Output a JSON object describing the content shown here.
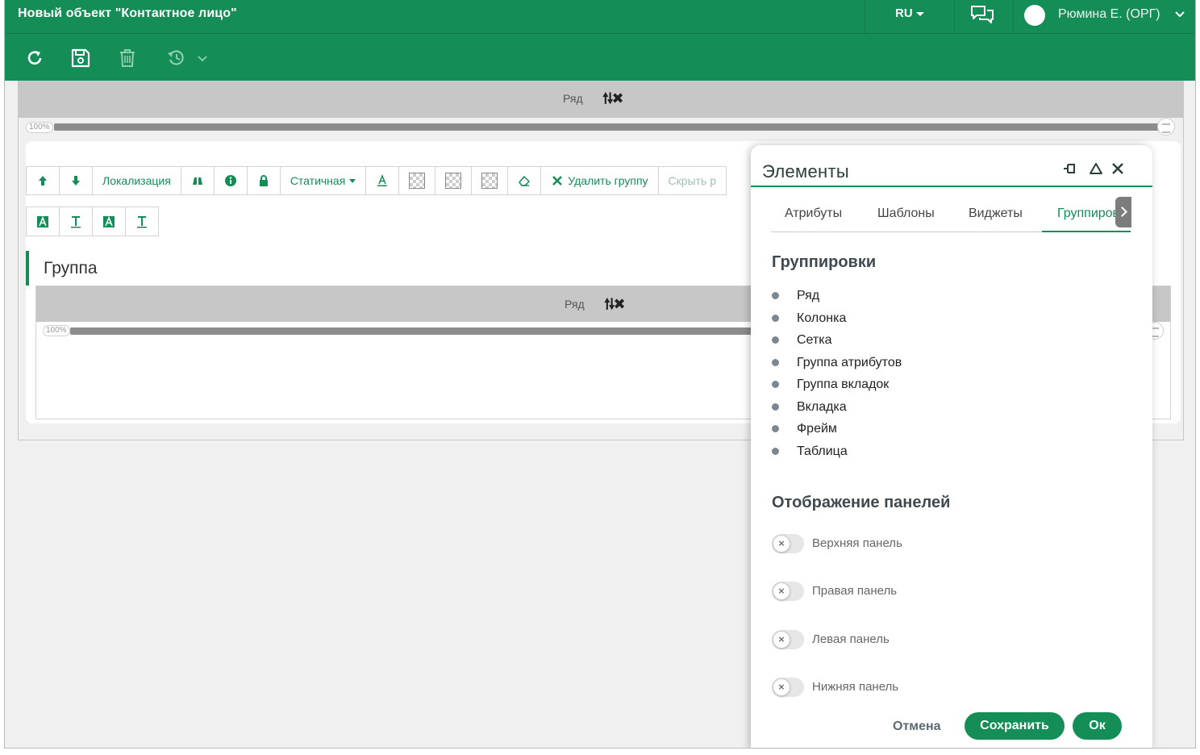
{
  "header": {
    "title": "Новый объект \"Контактное лицо\"",
    "language": "RU",
    "user_name": "Рюмина Е. (ОРГ)"
  },
  "toolbar": {
    "icons": [
      "refresh-icon",
      "save-icon",
      "delete-icon",
      "history-icon"
    ]
  },
  "workspace": {
    "row_label": "Ряд",
    "row_arrows": "🠕🠗✖",
    "width_value": "100%"
  },
  "group_editor": {
    "buttons": {
      "localization": "Локализация",
      "mode": "Статичная",
      "delete_group": "Удалить группу",
      "hide": "Скрыть р"
    },
    "group_title": "Группа",
    "inner_row_label": "Ряд",
    "inner_width_value": "100%"
  },
  "panel": {
    "title": "Элементы",
    "tabs": [
      "Атрибуты",
      "Шаблоны",
      "Виджеты",
      "Группировки"
    ],
    "active_tab": "Группировки",
    "groupings_title": "Группировки",
    "groupings": [
      "Ряд",
      "Колонка",
      "Сетка",
      "Группа атрибутов",
      "Группа вкладок",
      "Вкладка",
      "Фрейм",
      "Таблица"
    ],
    "panels_title": "Отображение панелей",
    "toggles": [
      {
        "label": "Верхняя панель",
        "on": false
      },
      {
        "label": "Правая панель",
        "on": false
      },
      {
        "label": "Левая панель",
        "on": false
      },
      {
        "label": "Нижняя панель",
        "on": false
      }
    ],
    "toggle_off_mark": "×",
    "cancel_label": "Отмена",
    "save_label": "Сохранить",
    "ok_label": "Ок"
  },
  "colors": {
    "brand": "#148d56",
    "row_header": "#c7c7c7"
  }
}
